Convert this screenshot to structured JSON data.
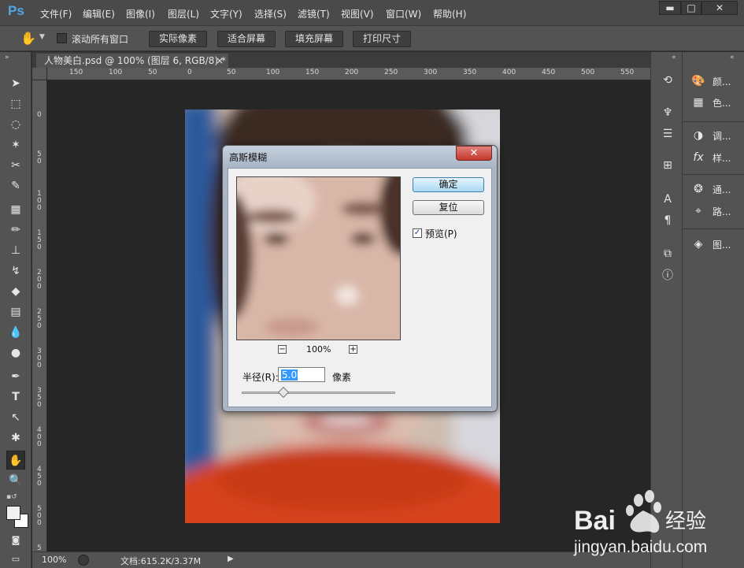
{
  "app": {
    "logo": "Ps"
  },
  "menu": [
    "文件(F)",
    "编辑(E)",
    "图像(I)",
    "图层(L)",
    "文字(Y)",
    "选择(S)",
    "滤镜(T)",
    "视图(V)",
    "窗口(W)",
    "帮助(H)"
  ],
  "window_controls": {
    "minimize": "▬",
    "maximize": "□",
    "close": "✕"
  },
  "options_bar": {
    "scroll_all_windows_label": "滚动所有窗口",
    "scroll_all_windows_checked": false,
    "buttons": [
      "实际像素",
      "适合屏幕",
      "填充屏幕",
      "打印尺寸"
    ]
  },
  "document": {
    "tab_title": "人物美白.psd @ 100% (图层 6, RGB/8) *",
    "tab_close": "×"
  },
  "ruler": {
    "top_ticks": [
      "150",
      "100",
      "50",
      "0",
      "50",
      "100",
      "150",
      "200",
      "250",
      "300",
      "350",
      "400",
      "450",
      "500",
      "550"
    ],
    "left_ticks": [
      "0",
      "5 0",
      "1 0 0",
      "1 5 0",
      "2 0 0",
      "2 5 0",
      "3 0 0",
      "3 5 0",
      "4 0 0",
      "4 5 0",
      "5 0 0",
      "5 5 0"
    ]
  },
  "status_bar": {
    "zoom": "100%",
    "doc_info": "文档:615.2K/3.37M"
  },
  "right_panels": [
    {
      "icon": "palette-icon",
      "label": "颜..."
    },
    {
      "icon": "swatches-icon",
      "label": "色..."
    },
    {
      "icon": "adjustments-icon",
      "label": "调..."
    },
    {
      "icon": "styles-icon",
      "label": "样..."
    },
    {
      "icon": "channels-icon",
      "label": "通..."
    },
    {
      "icon": "paths-icon",
      "label": "路..."
    },
    {
      "icon": "layers-icon",
      "label": "图..."
    }
  ],
  "dialog": {
    "title": "高斯模糊",
    "close": "✕",
    "ok_label": "确定",
    "reset_label": "复位",
    "preview_label": "预览(P)",
    "preview_checked": true,
    "zoom_out": "−",
    "zoom_in": "+",
    "preview_zoom": "100%",
    "radius_label": "半径(R):",
    "radius_value": "5.0",
    "radius_unit": "像素",
    "slider_fraction": 0.27
  },
  "watermark": {
    "text": "Bai 经验",
    "url_text": "jingyan.baidu.com"
  },
  "colors": {
    "accent": "#4ea8e8",
    "ok_button": "#a9d8f3"
  }
}
